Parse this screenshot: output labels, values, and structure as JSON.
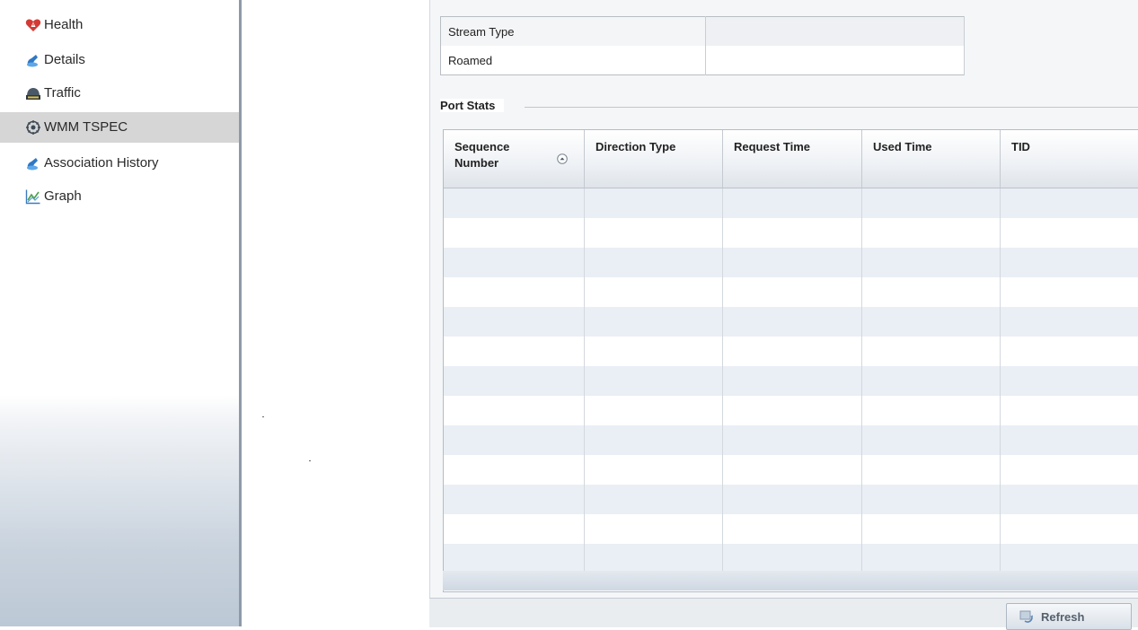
{
  "sidebar": {
    "items": [
      {
        "label": "Health",
        "icon": "health-heart-icon"
      },
      {
        "label": "Details",
        "icon": "details-icon"
      },
      {
        "label": "Traffic",
        "icon": "traffic-icon"
      },
      {
        "label": "WMM TSPEC",
        "icon": "wmm-tspec-icon",
        "active": true
      },
      {
        "label": "Association History",
        "icon": "association-history-icon"
      },
      {
        "label": "Graph",
        "icon": "graph-icon"
      }
    ]
  },
  "info_table": {
    "rows": [
      {
        "label": "Stream Type",
        "value": ""
      },
      {
        "label": "Roamed",
        "value": ""
      }
    ]
  },
  "port_stats": {
    "title": "Port Stats",
    "columns": [
      "Sequence Number",
      "Direction Type",
      "Request Time",
      "Used Time",
      "TID"
    ],
    "sorted_column": "Sequence Number",
    "rows": []
  },
  "footer": {
    "refresh_label": "Refresh"
  },
  "colors": {
    "active_nav": "#d6d6d6",
    "alt_row": "#eaeef5",
    "sidebar_border": "#8f9aa7"
  }
}
